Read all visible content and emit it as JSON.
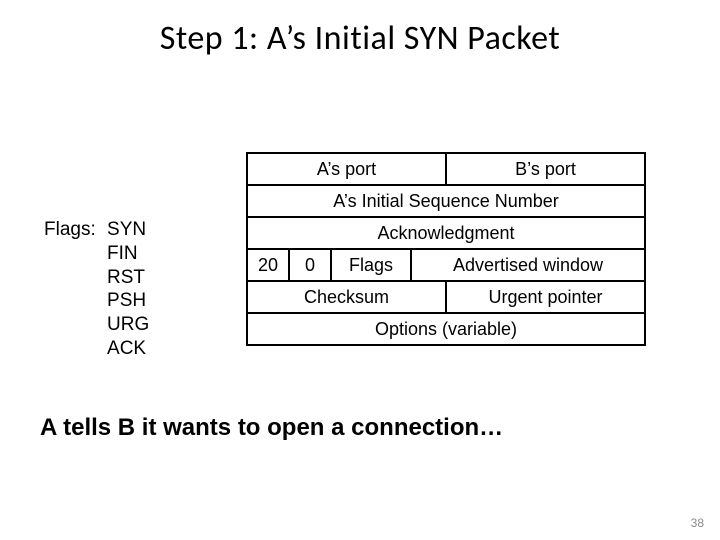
{
  "title": "Step 1: A’s Initial SYN Packet",
  "flags": {
    "label": "Flags:",
    "items": [
      "SYN",
      "FIN",
      "RST",
      "PSH",
      "URG",
      "ACK"
    ]
  },
  "tcp": {
    "src_port": "A’s port",
    "dst_port": "B’s port",
    "seq": "A’s Initial Sequence Number",
    "ack": "Acknowledgment",
    "hlen": "20",
    "reserved": "0",
    "flags_cell": "Flags",
    "adv_window": "Advertised window",
    "checksum": "Checksum",
    "urgent": "Urgent pointer",
    "options": "Options (variable)"
  },
  "caption": "A tells B it wants to open a connection…",
  "page_number": "38"
}
